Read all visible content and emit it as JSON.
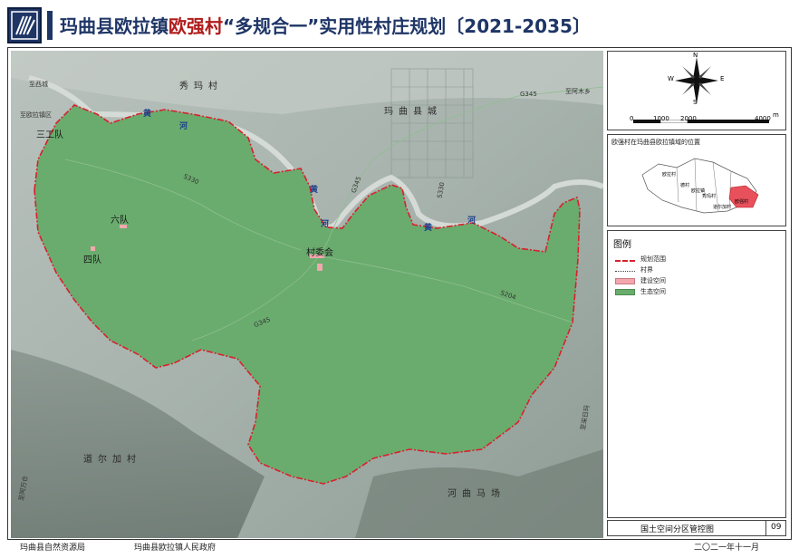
{
  "title": {
    "part1": "玛曲县欧拉镇",
    "highlight": "欧强村",
    "part2": "“多规合一”实用性村庄规划",
    "years": "〔2021-2035〕"
  },
  "map_labels": {
    "xiumacun": "秀玛村",
    "maquxiancheng": "玛曲县城",
    "sangongdui": "三工队",
    "liudui": "六队",
    "sidui": "四队",
    "cunweihui": "村委会",
    "daoerjiacun": "道尔加村",
    "hequmachang": "河曲马场",
    "road_g345_top": "G345",
    "road_g345": "G345",
    "road_s330": "S330",
    "road_s204": "S204",
    "road_g345b": "G345",
    "road_s330b": "S330",
    "river_huang1": "黄",
    "river_he1": "河",
    "river_huang2": "黄",
    "river_he2": "河",
    "river_huang3": "黄",
    "river_he3": "河",
    "edge_left_top": "至西城",
    "edge_left": "至欧拉镇区",
    "edge_right_top": "至阿木乡",
    "edge_bottom_left": "至阿万仓",
    "edge_right_bottom": "至采日玛"
  },
  "compass": {
    "n": "N",
    "s": "S",
    "e": "E",
    "w": "W"
  },
  "scale": {
    "ticks": [
      "0",
      "1000",
      "2000",
      "4000"
    ],
    "unit": "m"
  },
  "locator": {
    "title": "欧强村在玛曲县欧拉镇域的位置",
    "labels": [
      "欧拉村",
      "德村",
      "欧拉镇",
      "秀玛村",
      "道尔加村",
      "欧强村"
    ]
  },
  "legend": {
    "title": "图例",
    "items": [
      "规划范围",
      "村界",
      "建设空间",
      "生态空间"
    ]
  },
  "plan_name": "国土空间分区管控图",
  "plan_number": "09",
  "footer": {
    "org1": "玛曲县自然资源局",
    "org2": "玛曲县欧拉镇人民政府",
    "date": "二〇二一年十一月"
  },
  "colors": {
    "title": "#1e3566",
    "highlight": "#b01b1b",
    "ecological": "#6aac6e",
    "construction": "#f2a7ad",
    "boundary": "#d8202c"
  }
}
